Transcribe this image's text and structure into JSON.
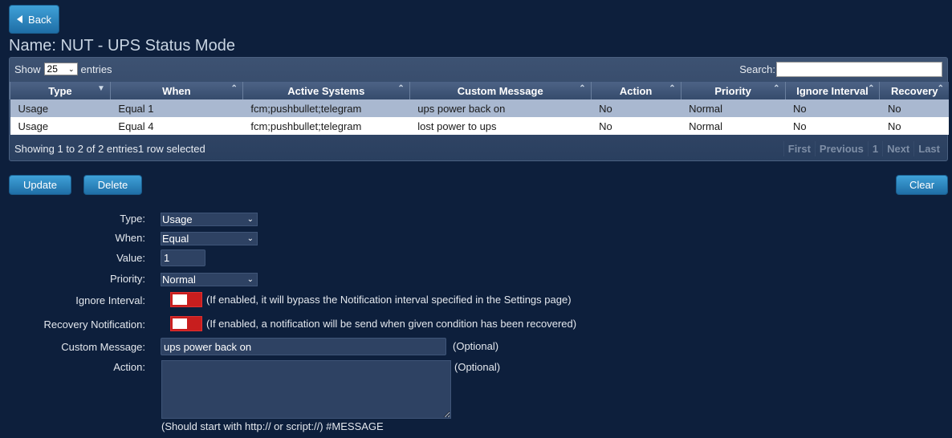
{
  "nav": {
    "back_label": "Back"
  },
  "page": {
    "title": "Name: NUT - UPS Status Mode"
  },
  "grid": {
    "show_label": "Show",
    "page_size": "25",
    "entries_label": "entries",
    "search_label": "Search:",
    "search_value": "",
    "columns": [
      "Type",
      "When",
      "Active Systems",
      "Custom Message",
      "Action",
      "Priority",
      "Ignore Interval",
      "Recovery"
    ],
    "rows": [
      [
        "Usage",
        "Equal 1",
        "fcm;pushbullet;telegram",
        "ups power back on",
        "No",
        "Normal",
        "No",
        "No"
      ],
      [
        "Usage",
        "Equal 4",
        "fcm;pushbullet;telegram",
        "lost power to ups",
        "No",
        "Normal",
        "No",
        "No"
      ]
    ],
    "selected_row": 0,
    "info": "Showing 1 to 2 of 2 entries1 row selected",
    "pager": {
      "first": "First",
      "previous": "Previous",
      "page": "1",
      "next": "Next",
      "last": "Last"
    }
  },
  "actions": {
    "update": "Update",
    "delete": "Delete",
    "clear": "Clear"
  },
  "form": {
    "type_label": "Type:",
    "type_value": "Usage",
    "when_label": "When:",
    "when_value": "Equal",
    "value_label": "Value:",
    "value_value": "1",
    "priority_label": "Priority:",
    "priority_value": "Normal",
    "ignore_label": "Ignore Interval:",
    "ignore_hint": "(If enabled, it will bypass the Notification interval specified in the Settings page)",
    "ignore_enabled": false,
    "recovery_label": "Recovery Notification:",
    "recovery_hint": "(If enabled, a notification will be send when given condition has been recovered)",
    "recovery_enabled": false,
    "message_label": "Custom Message:",
    "message_value": "ups power back on",
    "message_optional": "(Optional)",
    "action_label": "Action:",
    "action_value": "",
    "action_optional": "(Optional)",
    "action_hint": "(Should start with http:// or script://) #MESSAGE"
  },
  "colors": {
    "background": "#0d1f3c",
    "button": "#2a86c2",
    "toggle_off": "#c81e1e",
    "selected_row": "#a9b8d0"
  }
}
